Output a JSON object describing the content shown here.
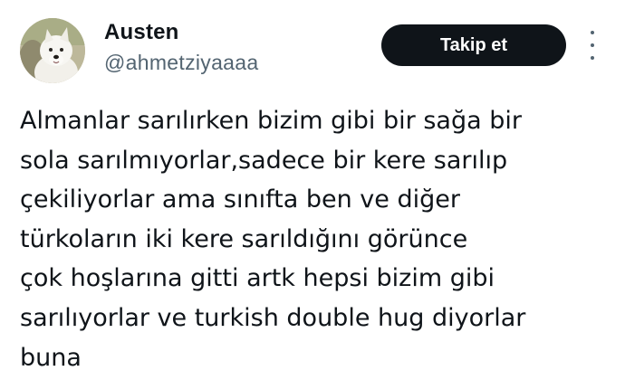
{
  "author": {
    "display_name": "Austen",
    "handle": "@ahmetziyaaaa"
  },
  "actions": {
    "follow_label": "Takip et",
    "more_icon": "more-vertical-icon"
  },
  "tweet": {
    "lines": [
      "Almanlar sarılırken bizim gibi bir sağa bir",
      "sola sarılmıyorlar,sadece bir kere sarılıp",
      "çekiliyorlar ama sınıfta ben ve diğer",
      "türkoların iki kere sarıldığını görünce",
      "çok hoşlarına gitti artk hepsi bizim gibi",
      "sarılıyorlar ve turkish double hug diyorlar",
      "buna"
    ]
  },
  "colors": {
    "text": "#0f1419",
    "secondary_text": "#536471",
    "button_bg": "#0f1419",
    "button_text": "#ffffff",
    "background": "#ffffff"
  }
}
